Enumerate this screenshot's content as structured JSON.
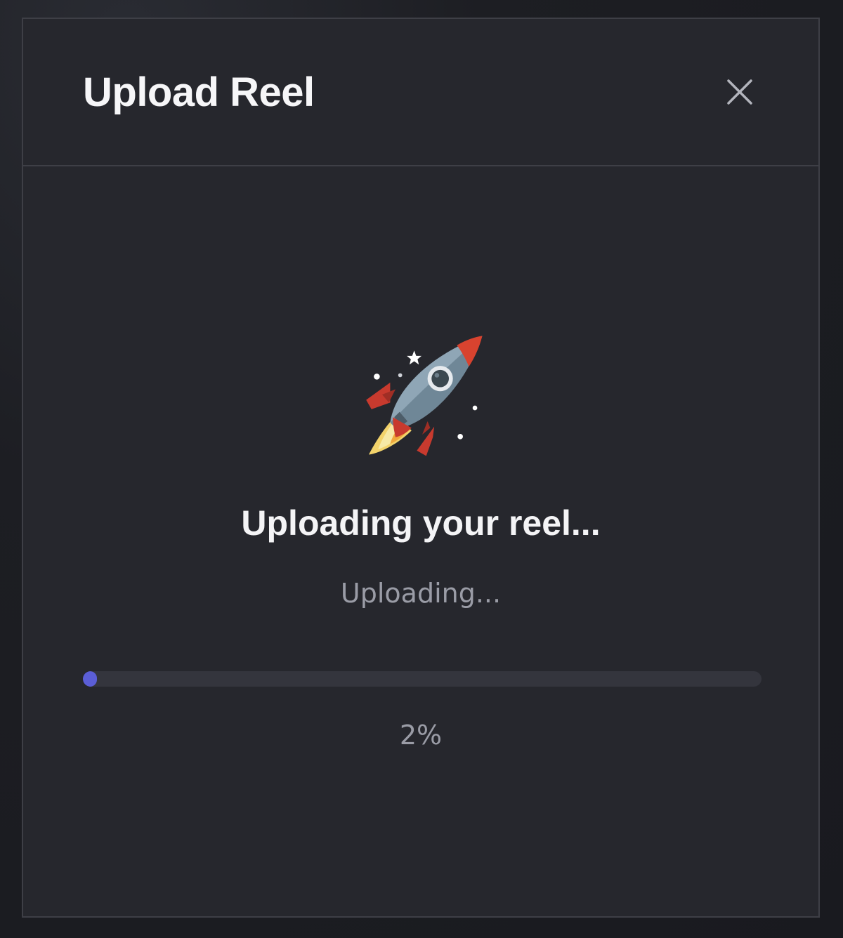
{
  "modal": {
    "title": "Upload Reel",
    "close_icon": "close-icon"
  },
  "upload": {
    "illustration_icon": "rocket-icon",
    "heading": "Uploading your reel...",
    "status": "Uploading...",
    "progress_fraction": 0.02,
    "percent_label": "2%"
  },
  "colors": {
    "modal_background": "#26272d",
    "border": "#3e3f46",
    "title_text": "#f6f6f8",
    "muted_text": "#9a9ca6",
    "progress_track": "#34353d",
    "progress_fill": "#5b5ed6"
  }
}
